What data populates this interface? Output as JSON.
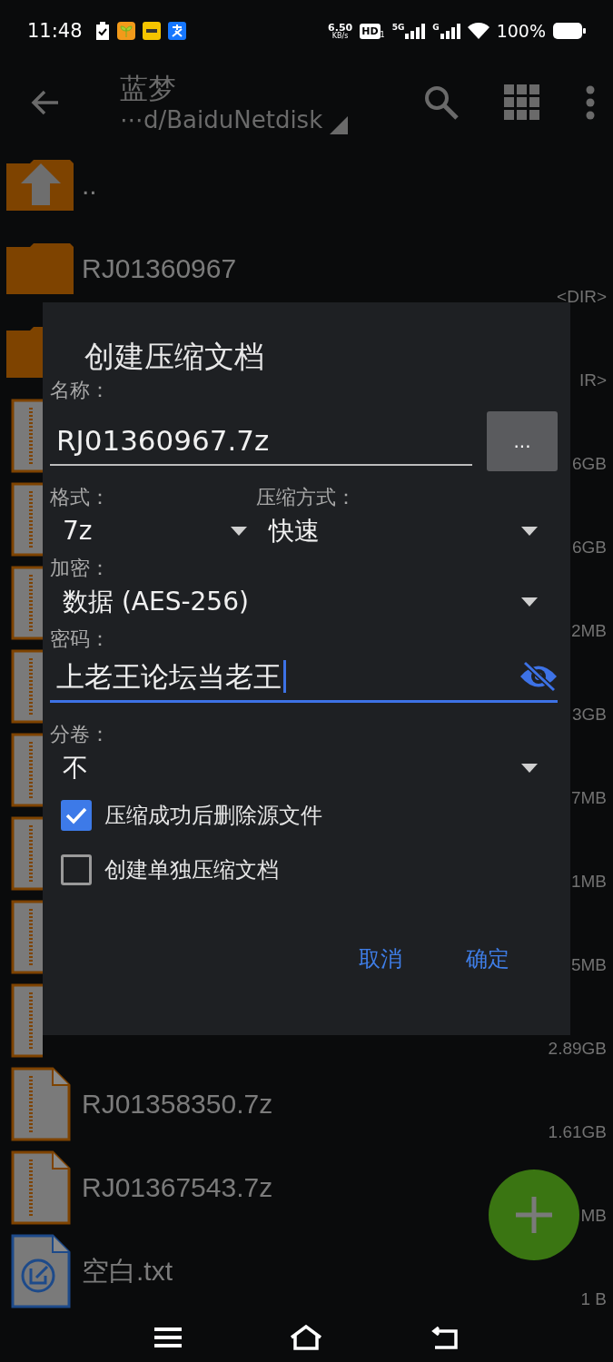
{
  "status_bar": {
    "time": "11:48",
    "speed_value": "6.50",
    "speed_unit": "KB/s",
    "hd_label": "HD",
    "hd_sim": "1",
    "networks": [
      "5G",
      "G"
    ],
    "battery": "100%"
  },
  "toolbar": {
    "title": "蓝梦",
    "path": "⋯d/BaiduNetdisk"
  },
  "files": [
    {
      "kind": "up",
      "name": ".."
    },
    {
      "kind": "folder",
      "name": "RJ01360967",
      "size": "<DIR>"
    },
    {
      "kind": "folder",
      "size": "IR>"
    },
    {
      "kind": "archive",
      "size": "6GB"
    },
    {
      "kind": "archive",
      "size": "6GB"
    },
    {
      "kind": "archive",
      "size": "2MB"
    },
    {
      "kind": "archive",
      "size": "3GB"
    },
    {
      "kind": "archive",
      "size": "7MB"
    },
    {
      "kind": "archive",
      "size": "1MB"
    },
    {
      "kind": "archive",
      "size": "5MB"
    },
    {
      "kind": "archive",
      "size": "2.89GB"
    },
    {
      "kind": "archive",
      "name": "RJ01358350.7z",
      "size": "1.61GB"
    },
    {
      "kind": "archive",
      "name": "RJ01367543.7z",
      "size": "MB"
    },
    {
      "kind": "text",
      "name": "空白.txt",
      "size": "1 B"
    }
  ],
  "dialog": {
    "title": "创建压缩文档",
    "name": {
      "label": "名称：",
      "value": "RJ01360967.7z",
      "browse_button": "..."
    },
    "format": {
      "label": "格式：",
      "value": "7z"
    },
    "method": {
      "label": "压缩方式：",
      "value": "快速"
    },
    "encryption": {
      "label": "加密：",
      "value": "数据 (AES-256)"
    },
    "password": {
      "label": "密码：",
      "value": "上老王论坛当老王",
      "focused": true
    },
    "split": {
      "label": "分卷：",
      "value": "不"
    },
    "options": [
      {
        "label": "压缩成功后删除源文件",
        "checked": true
      },
      {
        "label": "创建单独压缩文档",
        "checked": false
      }
    ],
    "buttons": [
      {
        "label": "取消"
      },
      {
        "label": "确定"
      }
    ]
  }
}
